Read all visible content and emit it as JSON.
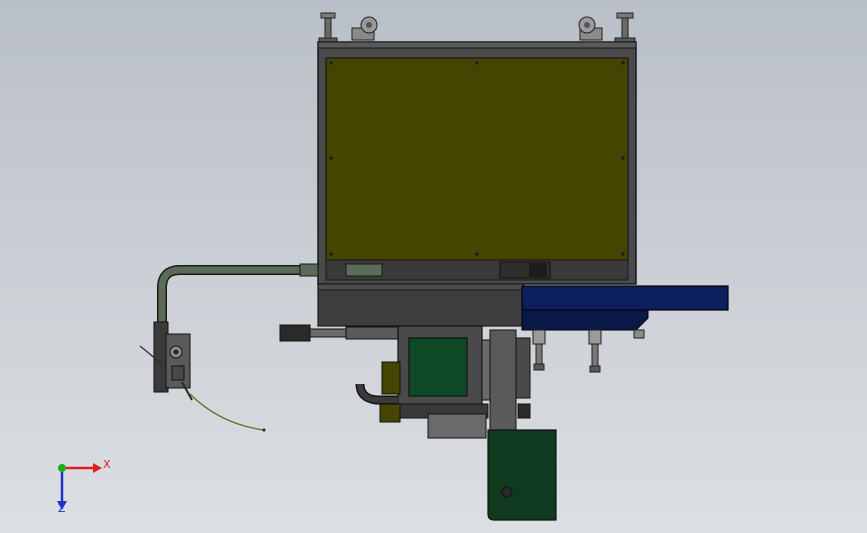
{
  "viewport": {
    "background_top": "#b9bfc6",
    "background_bottom": "#dcdfe3"
  },
  "model": {
    "enclosure_color": "#4a4a4a",
    "front_panel_color": "#454400",
    "base_plate_color": "#3e3e3e",
    "slide_rail_color": "#0d1f5c",
    "motor_color": "#0f4a26",
    "bracket_color": "#0f3a1f",
    "tube_color": "#5c6a5a"
  },
  "triad": {
    "x_label": "X",
    "z_label": "Z",
    "x_color": "#e02020",
    "y_color": "#18b018",
    "z_color": "#2030d0"
  }
}
